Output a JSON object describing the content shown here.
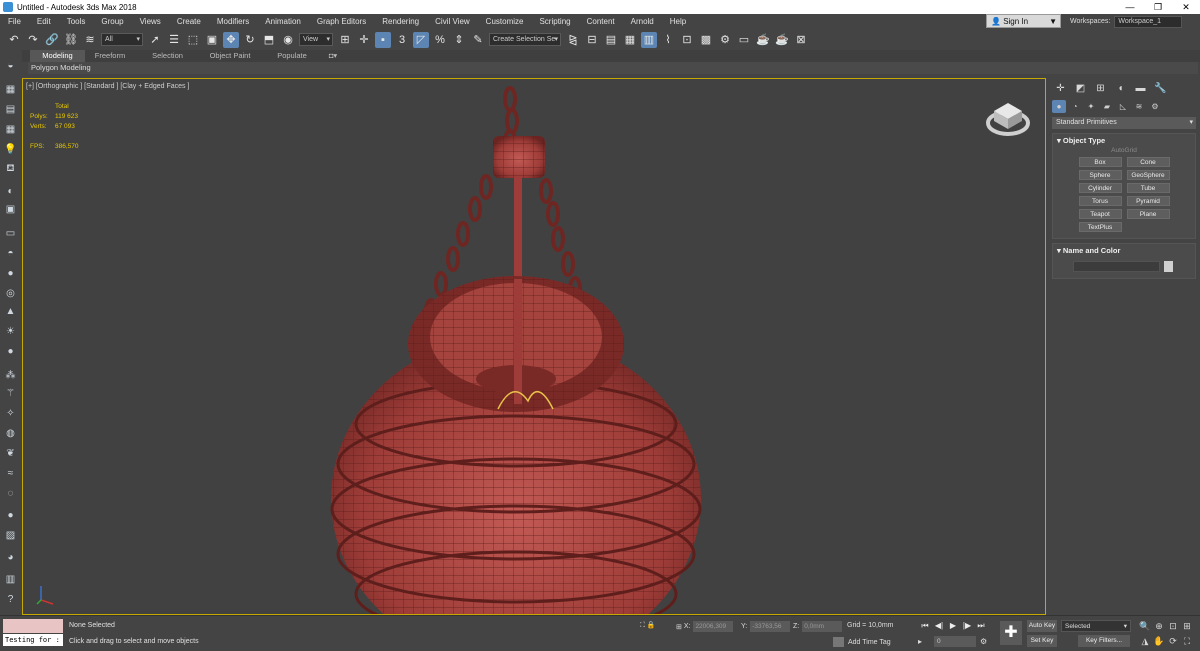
{
  "window": {
    "title": "Untitled - Autodesk 3ds Max 2018",
    "controls": [
      "—",
      "❐",
      "✕"
    ]
  },
  "menu": [
    "File",
    "Edit",
    "Tools",
    "Group",
    "Views",
    "Create",
    "Modifiers",
    "Animation",
    "Graph Editors",
    "Rendering",
    "Civil View",
    "Customize",
    "Scripting",
    "Content",
    "Arnold",
    "Help"
  ],
  "signin": {
    "label": "Sign In"
  },
  "workspaces": {
    "label": "Workspaces:",
    "value": "Workspace_1"
  },
  "toolbar": {
    "filter_value": "All",
    "view_value": "View",
    "named_selection": "Create Selection Se"
  },
  "ribbon": {
    "tabs": [
      "Modeling",
      "Freeform",
      "Selection",
      "Object Paint",
      "Populate"
    ],
    "subtitle": "Polygon Modeling"
  },
  "viewport": {
    "label": "[+] [Orthographic ] [Standard ] [Clay + Edged Faces ]",
    "stats": {
      "header": "Total",
      "polys_label": "Polys:",
      "polys": "119 623",
      "verts_label": "Verts:",
      "verts": "67 093",
      "fps_label": "FPS:",
      "fps": "386,570"
    }
  },
  "command_panel": {
    "category": "Standard Primitives",
    "object_type_title": "Object Type",
    "autogrid": "AutoGrid",
    "primitives": [
      "Box",
      "Cone",
      "Sphere",
      "GeoSphere",
      "Cylinder",
      "Tube",
      "Torus",
      "Pyramid",
      "Teapot",
      "Plane",
      "TextPlus"
    ],
    "name_color_title": "Name and Color"
  },
  "status": {
    "maxscript_input": "Testing for :",
    "selection": "None Selected",
    "prompt": "Click and drag to select and move objects",
    "x_label": "X:",
    "x_value": "22006,309",
    "y_label": "Y:",
    "y_value": "-33763,56",
    "z_label": "Z:",
    "z_value": "0,0mm",
    "grid": "Grid = 10,0mm",
    "add_time_tag": "Add Time Tag",
    "frame": "0",
    "auto_key": "Auto Key",
    "set_key": "Set Key",
    "selected_dd": "Selected",
    "key_filters": "Key Filters..."
  }
}
